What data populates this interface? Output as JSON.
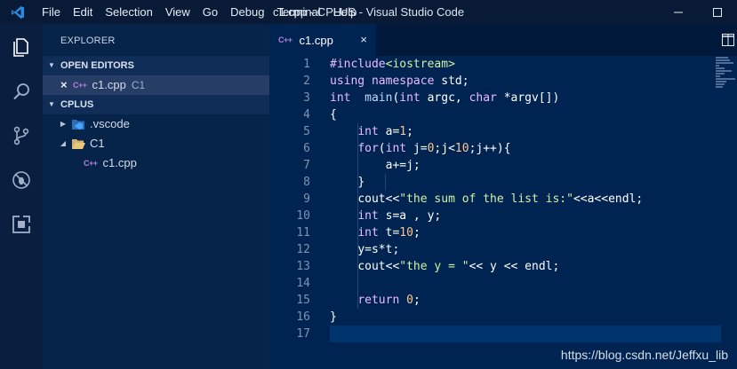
{
  "titlebar": {
    "menu": [
      "File",
      "Edit",
      "Selection",
      "View",
      "Go",
      "Debug",
      "Terminal",
      "Help"
    ],
    "window_title": "c1.cpp - CPLUS - Visual Studio Code"
  },
  "sidebar": {
    "title": "EXPLORER",
    "open_editors_label": "OPEN EDITORS",
    "open_editor": {
      "name": "c1.cpp",
      "folder": "C1"
    },
    "workspace_label": "CPLUS",
    "tree": {
      "vscode_folder": ".vscode",
      "c1_folder": "C1",
      "c1_file": "c1.cpp"
    }
  },
  "editor": {
    "tab_label": "c1.cpp",
    "cpp_icon_text": "C++",
    "line_numbers": [
      "1",
      "2",
      "3",
      "4",
      "5",
      "6",
      "7",
      "8",
      "9",
      "10",
      "11",
      "12",
      "13",
      "14",
      "15",
      "16",
      "17"
    ]
  },
  "code": {
    "l1a": "#include",
    "l1b": "<iostream>",
    "l2a": "using",
    "l2b": "namespace",
    "l2c": "std;",
    "l3a": "int",
    "l3b": "main",
    "l3c": "(",
    "l3d": "int",
    "l3e": " argc, ",
    "l3f": "char",
    "l3g": " *argv[])",
    "l4": "{",
    "l5a": "int",
    "l5b": " a=",
    "l5c": "1",
    "l5d": ";",
    "l6a": "for",
    "l6b": "(",
    "l6c": "int",
    "l6d": " j=",
    "l6e": "0",
    "l6f": ";j<",
    "l6g": "10",
    "l6h": ";j++){",
    "l7": "a+=j;",
    "l8": "}",
    "l9a": "cout<<",
    "l9b": "\"the sum of the list is:\"",
    "l9c": "<<a<<endl;",
    "l10a": "int",
    "l10b": " s=a , y;",
    "l11a": "int",
    "l11b": " t=",
    "l11c": "10",
    "l11d": ";",
    "l12": "y=s*t;",
    "l13a": "cout<<",
    "l13b": "\"the y = \"",
    "l13c": "<< y << endl;",
    "l15a": "return",
    "l15b": "0",
    "l15c": ";",
    "l16": "}"
  },
  "watermark": "https://blog.csdn.net/Jeffxu_lib",
  "colors": {
    "background": "#002451",
    "sidebar": "#062449",
    "activitybar": "#0a1f3f",
    "keyword": "#ebbbff",
    "string": "#d1f1a9",
    "number": "#ffc58f"
  }
}
